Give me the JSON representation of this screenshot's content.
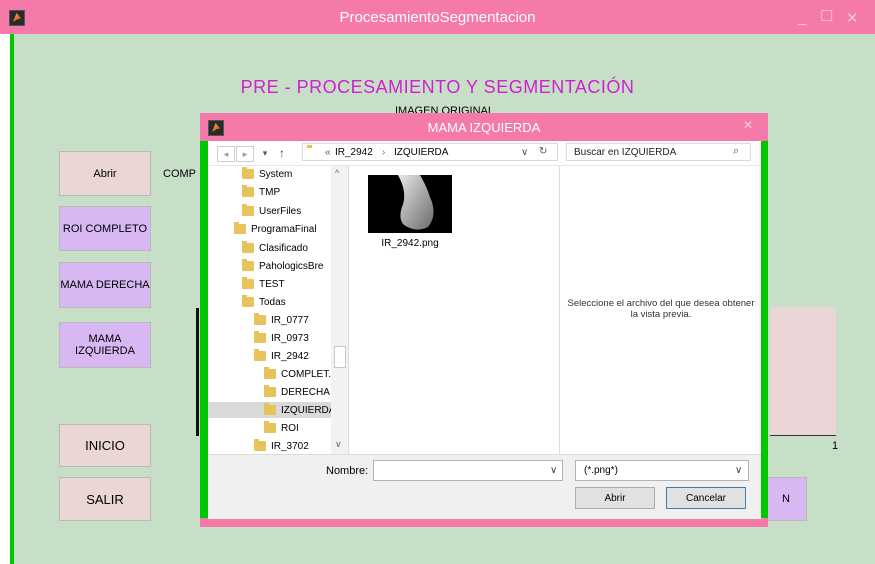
{
  "main": {
    "title": "ProcesamientoSegmentacion",
    "heading": "PRE - PROCESAMIENTO    Y   SEGMENTACIÓN",
    "image_label": "IMAGEN ORIGINAL",
    "comp_label": "COMP",
    "buttons": {
      "abrir": "Abrir",
      "roi_completo": "ROI COMPLETO",
      "mama_derecha": "MAMA DERECHA",
      "mama_izquierda": "MAMA IZQUIERDA",
      "inicio": "INICIO",
      "salir": "SALIR",
      "partial": "N"
    },
    "axis_tick": "1",
    "window_controls": {
      "minimize": "_",
      "maximize": "☐",
      "close": "✕"
    }
  },
  "dialog": {
    "title": "MAMA IZQUIERDA",
    "close": "✕",
    "address": {
      "prefix": "«",
      "crumbs": [
        "IR_2942",
        "IZQUIERDA"
      ],
      "separator": "›"
    },
    "search_placeholder": "Buscar en IZQUIERDA",
    "tree": [
      {
        "label": "System"
      },
      {
        "label": "TMP"
      },
      {
        "label": "UserFiles"
      },
      {
        "label": "ProgramaFinal"
      },
      {
        "label": "Clasificado"
      },
      {
        "label": "PahologicsBre"
      },
      {
        "label": "TEST"
      },
      {
        "label": "Todas"
      },
      {
        "label": "IR_0777"
      },
      {
        "label": "IR_0973"
      },
      {
        "label": "IR_2942"
      },
      {
        "label": "COMPLET."
      },
      {
        "label": "DERECHA"
      },
      {
        "label": "IZQUIERDA",
        "selected": true
      },
      {
        "label": "ROI"
      },
      {
        "label": "IR_3702"
      }
    ],
    "file": {
      "name": "IR_2942.png"
    },
    "preview_text": "Seleccione el archivo del que desea obtener la vista previa.",
    "footer": {
      "name_label": "Nombre:",
      "name_value": "",
      "filter": "(*.png*)",
      "open": "Abrir",
      "cancel": "Cancelar"
    }
  },
  "colors": {
    "titlebar": "#f57aa9",
    "background": "#c6dfc6",
    "frame_green": "#00c800",
    "heading": "#d11fd1",
    "button_pink": "#ebd6d6",
    "button_purple": "#d7b8f2"
  }
}
